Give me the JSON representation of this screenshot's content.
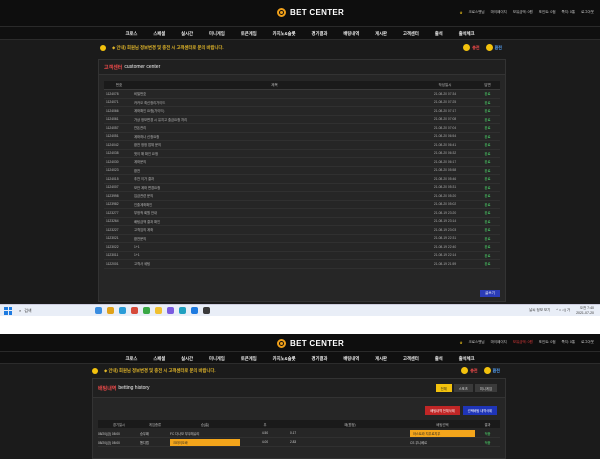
{
  "brand": {
    "logo_text": "BET CENTER"
  },
  "userbar": {
    "items": [
      "크로스벳님",
      "마이페이지",
      "보유금액: 0원",
      "포인트: 0점",
      "쪽지: 0통",
      "로그아웃"
    ]
  },
  "nav": {
    "items": [
      "크로스",
      "스페셜",
      "실시간",
      "미니게임",
      "토큰게임",
      "카지노&슬롯",
      "경기결과",
      "배팅내역",
      "게시판",
      "고객센터",
      "출석",
      "출석체크"
    ]
  },
  "marquee": {
    "text": "◆ 안내) 회원님 정보변경 및 충전 시 고객센터로 문의 바랍니다."
  },
  "quick": {
    "charge": "충전",
    "exchange": "환전"
  },
  "support": {
    "title_ko": "고객센터",
    "title_en": "customer center",
    "columns": [
      "번호",
      "제목",
      "작성일시",
      "답변"
    ],
    "rows": [
      {
        "no": "1124078",
        "title": "비밀번호",
        "date": "21-08-20 07:34",
        "status": "완료"
      },
      {
        "no": "1124071",
        "title": "카카오 최신정리가이드",
        "date": "21-08-20 07:25",
        "status": "완료"
      },
      {
        "no": "1124066",
        "title": "계좌확인 요청(가이드)",
        "date": "21-08-20 07:17",
        "status": "완료"
      },
      {
        "no": "1124061",
        "title": "가상 정보변경 시 유지고 출금요청 처리",
        "date": "21-08-20 07:08",
        "status": "완료"
      },
      {
        "no": "1124057",
        "title": "잔돈관리",
        "date": "21-08-20 07:04",
        "status": "완료"
      },
      {
        "no": "1124051",
        "title": "계좌하나 신청요청",
        "date": "21-08-20 06:54",
        "status": "완료"
      },
      {
        "no": "1124042",
        "title": "환전 정정 업체 문의",
        "date": "21-08-20 06:41",
        "status": "완료"
      },
      {
        "no": "1124038",
        "title": "첫이 해 확인 요청",
        "date": "21-08-20 06:32",
        "status": "완료"
      },
      {
        "no": "1124030",
        "title": "계좌문의",
        "date": "21-08-20 06:17",
        "status": "완료"
      },
      {
        "no": "1124023",
        "title": "환전",
        "date": "21-08-20 05:58",
        "status": "완료"
      },
      {
        "no": "1124015",
        "title": "추천 이가 결과",
        "date": "21-08-20 05:46",
        "status": "완료"
      },
      {
        "no": "1124007",
        "title": "보안 계좌 변경요청",
        "date": "21-08-20 05:31",
        "status": "완료"
      },
      {
        "no": "1123998",
        "title": "입금관련 문의",
        "date": "21-08-20 05:20",
        "status": "완료"
      },
      {
        "no": "1123982",
        "title": "인출계좌확인",
        "date": "21-08-20 05:02",
        "status": "완료"
      },
      {
        "no": "1123277",
        "title": "부정적 회원 안내",
        "date": "21-08-19 23:20",
        "status": "완료"
      },
      {
        "no": "1123264",
        "title": "배팅금액 결과 확인",
        "date": "21-08-19 23:14",
        "status": "완료"
      },
      {
        "no": "1123227",
        "title": "고객임의 계좌",
        "date": "21-08-19 23:03",
        "status": "완료"
      },
      {
        "no": "1123021",
        "title": "환전문의",
        "date": "21-08-19 22:31",
        "status": "완료"
      },
      {
        "no": "1123022",
        "title": "1+1",
        "date": "21-08-19 22:40",
        "status": "완료"
      },
      {
        "no": "1123011",
        "title": "1+1",
        "date": "21-08-19 22:14",
        "status": "완료"
      },
      {
        "no": "1122001",
        "title": "고객사 세팅",
        "date": "21-08-19 21:59",
        "status": "완료"
      }
    ],
    "pager_label": "글쓰기"
  },
  "taskbar": {
    "search_placeholder": "검색",
    "tray_text": "날씨 정보 보기",
    "time": "오전 7:40",
    "date": "2021-07-20"
  },
  "betting": {
    "title_ko": "배팅내역",
    "title_en": "betting history",
    "filters": [
      "전체",
      "스포츠",
      "미니게임"
    ],
    "actions": {
      "cancel_selected": "배팅내역 전체삭제",
      "delete_selected": "선택배팅 내역삭제"
    },
    "columns": [
      "경기일시",
      "게임종류",
      "승(홈)",
      "무",
      "패(원정)",
      "배팅선택",
      "결과"
    ],
    "rows": [
      {
        "date": "08/20(금) 08:00",
        "type": "승무패",
        "home": "FC 다나모 부쿠레슈티",
        "draw": "4.50",
        "away": "0.17",
        "pick": "아스트라 지우르지우",
        "result": "적중"
      },
      {
        "date": "08/20(금) 08:00",
        "type": "핸디캡",
        "home": "크라이오바",
        "draw": "4.00",
        "away": "2.83",
        "pick": "CS 우니베르",
        "result": "적중"
      }
    ]
  },
  "colors": {
    "accent": "#f3c20d",
    "win": "#4cd66a",
    "danger": "#c02626",
    "primary": "#1f35b8"
  }
}
